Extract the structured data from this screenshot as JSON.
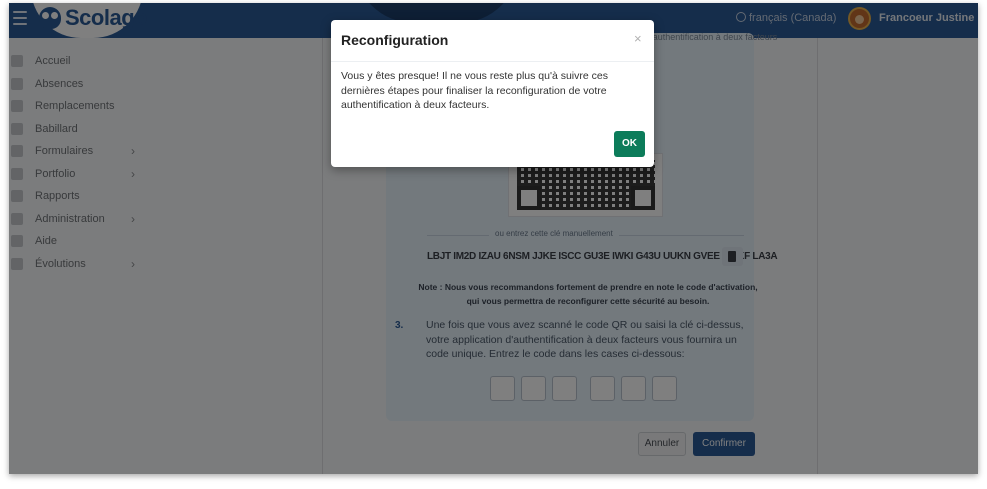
{
  "header": {
    "logo_text": "Scolago",
    "language_label": "français (Canada)",
    "user_name": "Francoeur Justine"
  },
  "sidebar": {
    "items": [
      {
        "label": "Accueil",
        "icon": "home-icon",
        "has_children": false
      },
      {
        "label": "Absences",
        "icon": "user-absent-icon",
        "has_children": false
      },
      {
        "label": "Remplacements",
        "icon": "swap-icon",
        "has_children": false
      },
      {
        "label": "Babillard",
        "icon": "board-icon",
        "has_children": false
      },
      {
        "label": "Formulaires",
        "icon": "form-icon",
        "has_children": true
      },
      {
        "label": "Portfolio",
        "icon": "trophy-icon",
        "has_children": true
      },
      {
        "label": "Rapports",
        "icon": "report-icon",
        "has_children": false
      },
      {
        "label": "Administration",
        "icon": "gear-icon",
        "has_children": true
      },
      {
        "label": "Aide",
        "icon": "help-icon",
        "has_children": false
      },
      {
        "label": "Évolutions",
        "icon": "sprout-icon",
        "has_children": true
      }
    ],
    "chevron": "›"
  },
  "page": {
    "header_fragment": "l'authentification à deux facteurs",
    "or_text": "ou entrez cette clé manuellement",
    "manual_key": "LBJT IM2D IZAU 6NSM JJKE ISCC GU3E IWKI G43U UUKN GVEE MNKF LA3A",
    "note": "Note : Nous vous recommandons fortement de prendre en note le code d'activation, qui vous permettra de reconfigurer cette sécurité au besoin.",
    "step_number": "3.",
    "step_text": "Une fois que vous avez scanné le code QR ou saisi la clé ci-dessus, votre application d'authentification à deux facteurs vous fournira un code unique. Entrez le code dans les cases ci-dessous:",
    "code_digits": [
      "",
      "",
      "",
      "",
      "",
      ""
    ],
    "cancel_label": "Annuler",
    "confirm_label": "Confirmer"
  },
  "modal": {
    "title": "Reconfiguration",
    "close_label": "×",
    "body": "Vous y êtes presque! Il ne vous reste plus qu'à suivre ces dernières étapes pour finaliser la reconfiguration de votre authentification à deux facteurs.",
    "ok_label": "OK"
  },
  "colors": {
    "brand": "#2b5a96",
    "ok_button": "#0c7c5a",
    "card_background": "#e6f2fb"
  }
}
